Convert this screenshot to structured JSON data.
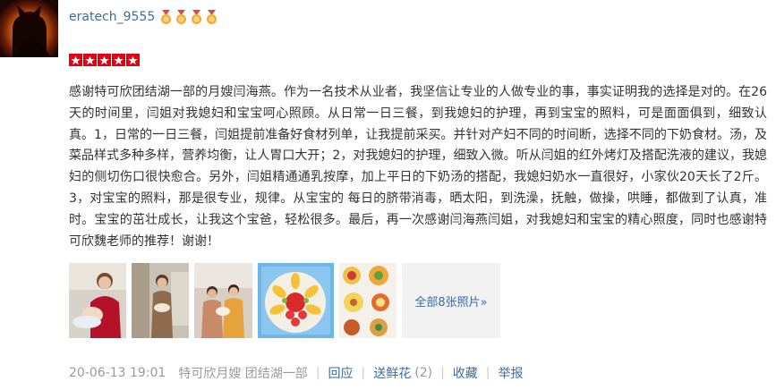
{
  "user": {
    "name": "eratech_9555",
    "medal_count": 4,
    "avatar_icon": "cat-silhouette-sunset-avatar"
  },
  "rating": {
    "stars": 5,
    "max": 5,
    "color": "#e60012"
  },
  "review": {
    "text": "感谢特可欣团结湖一部的月嫂闫海燕。作为一名技术从业者，我坚信让专业的人做专业的事，事实证明我的选择是对的。在26天的时间里，闫姐对我媳妇和宝宝呵心照顾。从日常一日三餐，到我媳妇的护理，再到宝宝的照料，可是面面俱到，细致认真。1，日常的一日三餐，闫姐提前准备好食材列单，让我提前采买。并针对产妇不同的时间断，选择不同的下奶食材。汤，及菜品样式多种多样，营养均衡，让人胃口大开；2，对我媳妇的护理，细致入微。听从闫姐的红外烤灯及搭配洗液的建议，我媳妇的侧切伤口很快愈合。另外，闫姐精通通乳按摩，加上平日的下奶汤的搭配，我媳妇奶水一直很好，小家伙20天长了2斤。3，对宝宝的照料，那是很专业，规律。从宝宝的 每日的脐带消毒，晒太阳，到洗澡，抚触，做操，哄睡，都做到了认真，准时。宝宝的茁壮成长，让我这个宝爸，轻松很多。最后，再一次感谢闫海燕闫姐，对我媳妇和宝宝的精心照度，同时也感谢特可欣魏老师的推荐！谢谢！"
  },
  "photos": {
    "thumbnails": [
      "photo-nanny-with-baby",
      "photo-nanny-standing",
      "photo-two-women-with-baby",
      "photo-fruit-platter",
      "photo-meal-dishes"
    ],
    "more_label": "全部8张照片»"
  },
  "footer": {
    "date": "20-06-13 19:01",
    "meta": "特可欣月嫂 团结湖一部",
    "reply_label": "回应",
    "flower_label": "送鲜花",
    "flower_count": "(2)",
    "favorite_label": "收藏",
    "report_label": "举报"
  },
  "colors": {
    "link": "#3e6b9c",
    "muted": "#999999",
    "text": "#333333",
    "medal": "#e8a23a"
  }
}
